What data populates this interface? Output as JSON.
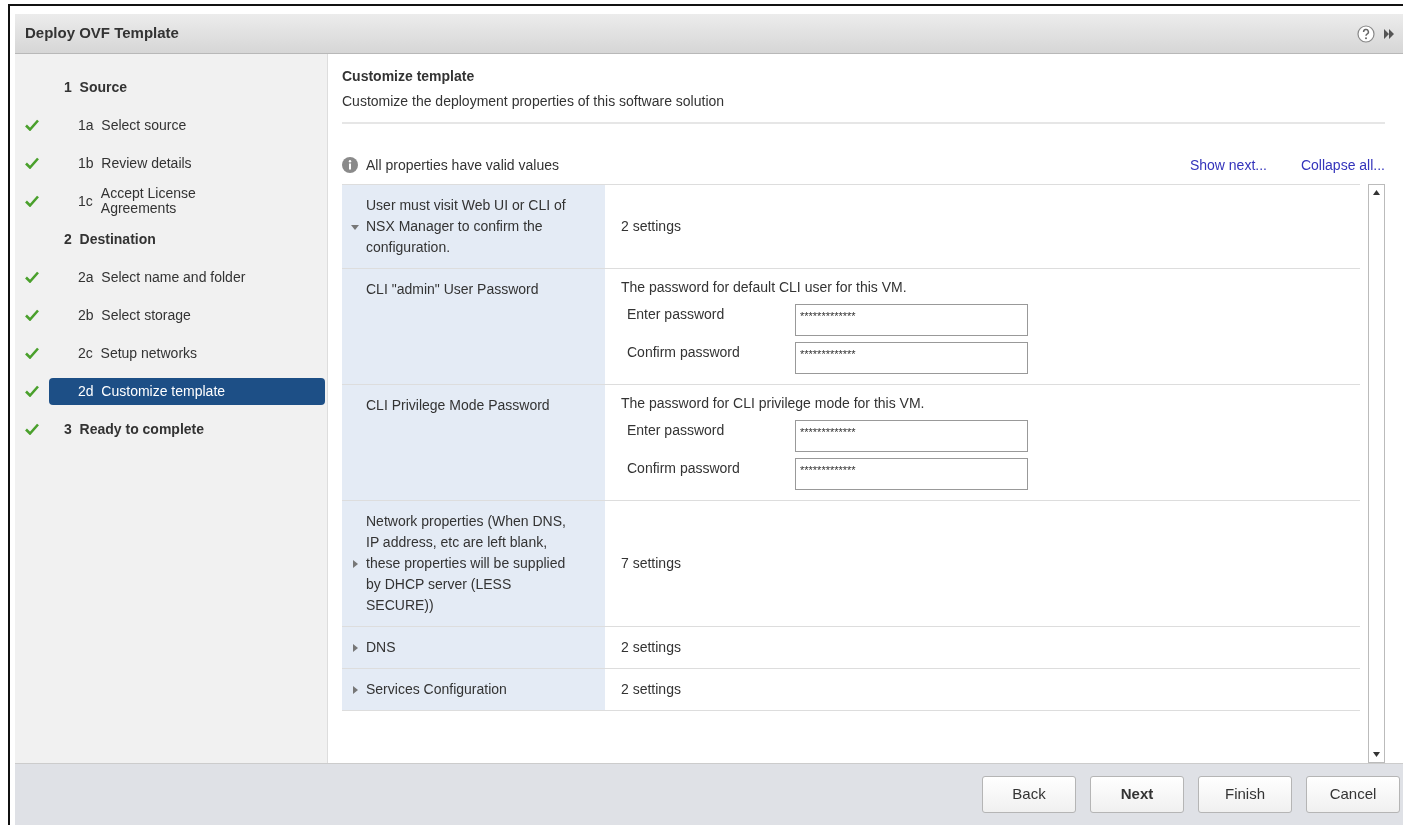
{
  "window": {
    "title": "Deploy OVF Template"
  },
  "steps": [
    {
      "kind": "group",
      "number": "1",
      "label": "Source",
      "done": false,
      "selected": false
    },
    {
      "kind": "step",
      "number": "1a",
      "label": "Select source",
      "done": true,
      "selected": false
    },
    {
      "kind": "step",
      "number": "1b",
      "label": "Review details",
      "done": true,
      "selected": false
    },
    {
      "kind": "step",
      "number": "1c",
      "label": "Accept License Agreements",
      "done": true,
      "selected": false
    },
    {
      "kind": "group",
      "number": "2",
      "label": "Destination",
      "done": false,
      "selected": false
    },
    {
      "kind": "step",
      "number": "2a",
      "label": "Select name and folder",
      "done": true,
      "selected": false
    },
    {
      "kind": "step",
      "number": "2b",
      "label": "Select storage",
      "done": true,
      "selected": false
    },
    {
      "kind": "step",
      "number": "2c",
      "label": "Setup networks",
      "done": true,
      "selected": false
    },
    {
      "kind": "step",
      "number": "2d",
      "label": "Customize template",
      "done": true,
      "selected": true
    },
    {
      "kind": "group",
      "number": "3",
      "label": "Ready to complete",
      "done": true,
      "selected": false
    }
  ],
  "page": {
    "title": "Customize template",
    "subtitle": "Customize the deployment properties of this software solution"
  },
  "validation": {
    "message": "All properties have valid values"
  },
  "links": [
    "Show next...",
    "Collapse all..."
  ],
  "properties": [
    {
      "kind": "group",
      "label": "User must visit Web UI or CLI of NSX Manager to confirm the configuration.",
      "expanded": true,
      "summary": "2 settings"
    },
    {
      "kind": "password",
      "label": "CLI \"admin\" User Password",
      "description": "The password for default CLI user for this VM.",
      "fields": [
        {
          "label": "Enter password",
          "value": "*************"
        },
        {
          "label": "Confirm password",
          "value": "*************"
        }
      ]
    },
    {
      "kind": "password",
      "label": "CLI Privilege Mode Password",
      "description": "The password for CLI privilege mode for this VM.",
      "fields": [
        {
          "label": "Enter password",
          "value": "*************"
        },
        {
          "label": "Confirm password",
          "value": "*************"
        }
      ]
    },
    {
      "kind": "group",
      "label": "Network properties (When DNS, IP address, etc are left blank, these properties will be supplied by DHCP server (LESS SECURE))",
      "expanded": false,
      "summary": "7 settings"
    },
    {
      "kind": "group",
      "label": "DNS",
      "expanded": false,
      "summary": "2 settings"
    },
    {
      "kind": "group",
      "label": "Services Configuration",
      "expanded": false,
      "summary": "2 settings"
    }
  ],
  "buttons": [
    {
      "label": "Back",
      "default": false
    },
    {
      "label": "Next",
      "default": true
    },
    {
      "label": "Finish",
      "default": false
    },
    {
      "label": "Cancel",
      "default": false
    }
  ]
}
